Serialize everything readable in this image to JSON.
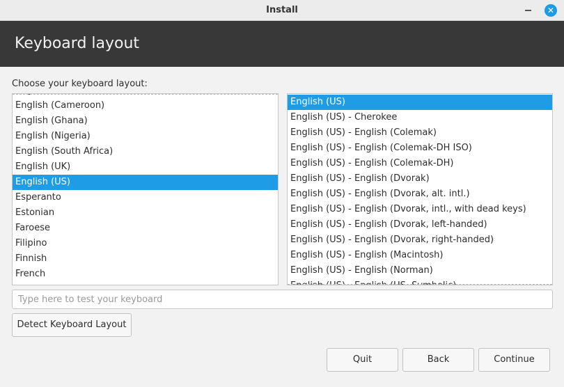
{
  "window": {
    "title": "Install"
  },
  "header": {
    "title": "Keyboard layout"
  },
  "prompt": "Choose your keyboard layout:",
  "layouts": {
    "selected": "English (US)",
    "items": [
      "English (Australian)",
      "English (Cameroon)",
      "English (Ghana)",
      "English (Nigeria)",
      "English (South Africa)",
      "English (UK)",
      "English (US)",
      "Esperanto",
      "Estonian",
      "Faroese",
      "Filipino",
      "Finnish",
      "French"
    ]
  },
  "variants": {
    "selected": "English (US)",
    "items": [
      "English (US)",
      "English (US) - Cherokee",
      "English (US) - English (Colemak)",
      "English (US) - English (Colemak-DH ISO)",
      "English (US) - English (Colemak-DH)",
      "English (US) - English (Dvorak)",
      "English (US) - English (Dvorak, alt. intl.)",
      "English (US) - English (Dvorak, intl., with dead keys)",
      "English (US) - English (Dvorak, left-handed)",
      "English (US) - English (Dvorak, right-handed)",
      "English (US) - English (Macintosh)",
      "English (US) - English (Norman)",
      "English (US) - English (US, Symbolic)"
    ]
  },
  "test_input": {
    "placeholder": "Type here to test your keyboard",
    "value": ""
  },
  "buttons": {
    "detect": "Detect Keyboard Layout",
    "quit": "Quit",
    "back": "Back",
    "continue": "Continue"
  },
  "icons": {
    "close": "close-icon",
    "minimize": "minimize-icon"
  },
  "colors": {
    "accent": "#1e9de6",
    "header_bg": "#383838"
  }
}
